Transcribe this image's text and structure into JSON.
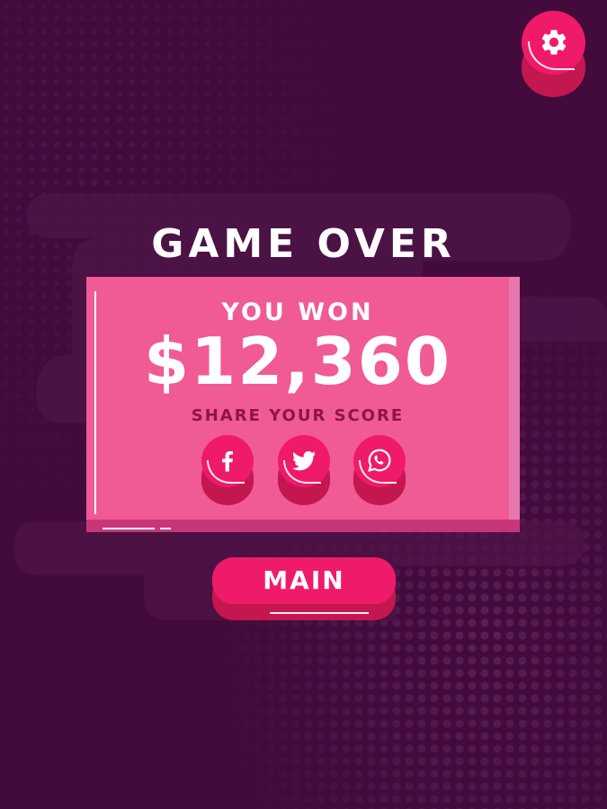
{
  "screen": {
    "title": "GAME OVER",
    "background_color": "#430b3b",
    "accent_color": "#f01a6a",
    "card_color": "#f05a95"
  },
  "result": {
    "won_label": "YOU WON",
    "amount": "$12,360"
  },
  "share": {
    "label": "SHARE YOUR SCORE",
    "buttons": [
      {
        "icon": "facebook-icon"
      },
      {
        "icon": "twitter-icon"
      },
      {
        "icon": "whatsapp-icon"
      }
    ]
  },
  "main_button": {
    "label": "MAIN"
  },
  "settings_button": {
    "icon": "gear-icon"
  }
}
